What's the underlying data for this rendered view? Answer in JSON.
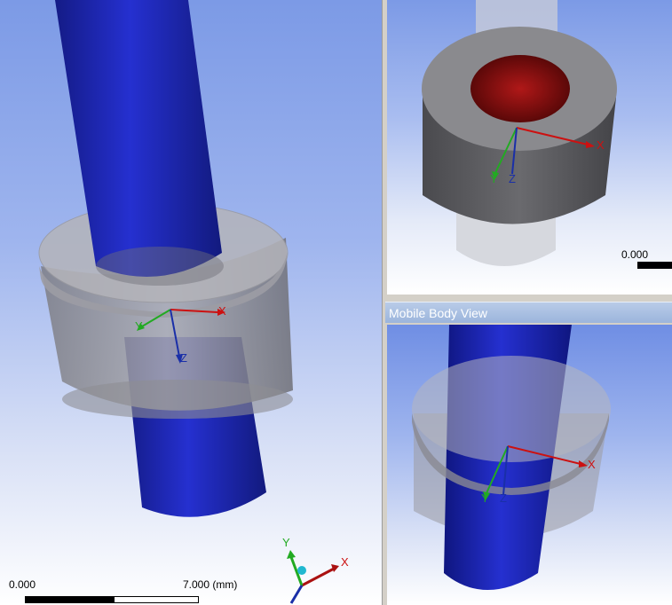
{
  "main_view": {
    "scale": {
      "start": "0.000",
      "end": "7.000 (mm)"
    },
    "axes": {
      "x": "X",
      "y": "Y",
      "z": "Z"
    },
    "triad": {
      "x": "X",
      "y": "Y"
    }
  },
  "reference_view": {
    "scale": {
      "start": "0.000"
    },
    "axes": {
      "x": "X",
      "y": "Y",
      "z": "Z"
    }
  },
  "mobile_view": {
    "title": "Mobile Body View",
    "axes": {
      "x": "X",
      "y": "Y",
      "z": "Z"
    }
  },
  "colors": {
    "shaft": "#1a23b8",
    "ring": "#8e8e94",
    "bore": "#8a1010",
    "x_axis": "#cc1111",
    "y_axis": "#22aa22",
    "z_axis": "#1a2fa8"
  }
}
